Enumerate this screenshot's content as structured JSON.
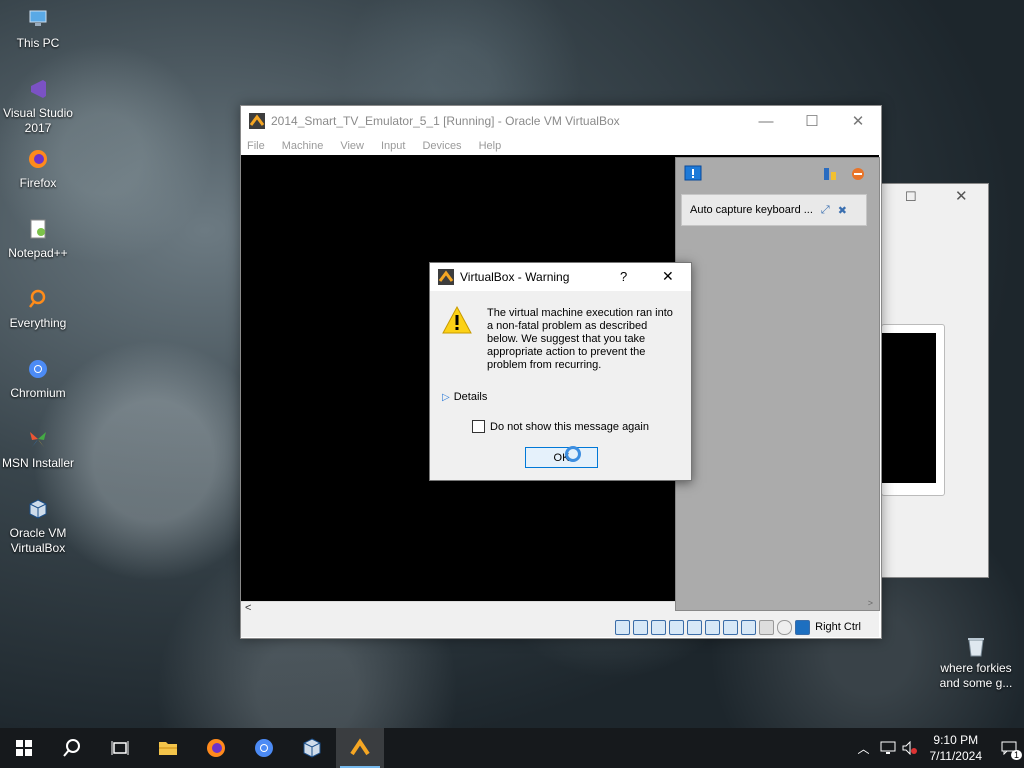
{
  "desktop_icons": [
    {
      "label": "This PC"
    },
    {
      "label": "Visual Studio 2017"
    },
    {
      "label": "Firefox"
    },
    {
      "label": "Notepad++"
    },
    {
      "label": "Everything"
    },
    {
      "label": "Chromium"
    },
    {
      "label": "MSN Installer"
    },
    {
      "label": "Oracle VM VirtualBox"
    }
  ],
  "desktop_file": {
    "label": "where forkies and some g..."
  },
  "vbox_window": {
    "title": "2014_Smart_TV_Emulator_5_1 [Running] - Oracle VM VirtualBox",
    "menu": [
      "File",
      "Machine",
      "View",
      "Input",
      "Devices",
      "Help"
    ],
    "host_key_label": "Right Ctrl"
  },
  "notification_panel": {
    "item_text": "Auto capture keyboard ..."
  },
  "warning_dialog": {
    "title": "VirtualBox - Warning",
    "help_label": "?",
    "close_label": "✕",
    "message": "The virtual machine execution ran into a non-fatal problem as described below. We suggest that you take appropriate action to prevent the problem from recurring.",
    "details_label": "Details",
    "checkbox_label": "Do not show this message again",
    "checkbox_checked": false,
    "ok_label": "OK"
  },
  "taskbar": {
    "clock_time": "9:10 PM",
    "clock_date": "7/11/2024",
    "notification_count": "1"
  }
}
